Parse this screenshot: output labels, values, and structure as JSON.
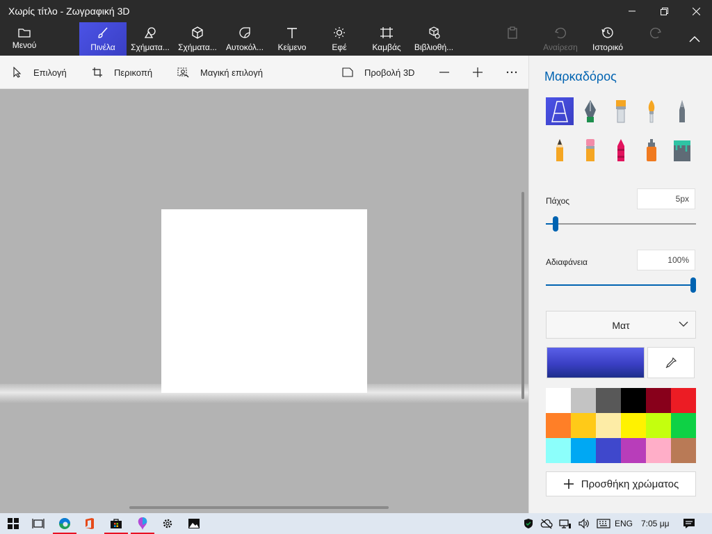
{
  "window": {
    "title": "Χωρίς τίτλο - Ζωγραφική 3D"
  },
  "ribbon": {
    "menu": "Μενού",
    "brushes": "Πινέλα",
    "shapes2d": "Σχήματα...",
    "shapes3d": "Σχήματα...",
    "stickers": "Αυτοκόλ...",
    "text": "Κείμενο",
    "effects": "Εφέ",
    "canvas": "Καμβάς",
    "library": "Βιβλιοθή...",
    "undo": "Αναίρεση",
    "history": "Ιστορικό"
  },
  "toolbar": {
    "select": "Επιλογή",
    "crop": "Περικοπή",
    "magic_select": "Μαγική επιλογή",
    "view3d": "Προβολή 3D"
  },
  "panel": {
    "title": "Μαρκαδόρος",
    "thickness_label": "Πάχος",
    "thickness_value": "5px",
    "thickness_level": 0.05,
    "opacity_label": "Αδιαφάνεια",
    "opacity_value": "100%",
    "opacity_level": 1.0,
    "finish_value": "Ματ",
    "add_color": "Προσθήκη χρώματος",
    "current_color": "#3a3fc4",
    "palette": [
      "#ffffff",
      "#c3c3c3",
      "#585858",
      "#000000",
      "#88001b",
      "#ec1c24",
      "#ff7f27",
      "#ffca18",
      "#fdeca6",
      "#fff200",
      "#c4ff0e",
      "#0ed145",
      "#8cfffb",
      "#00a8f3",
      "#3f48cc",
      "#b83dba",
      "#ffaec8",
      "#b97a56"
    ]
  },
  "accent_color": "#3f48cc",
  "taskbar": {
    "language": "ENG",
    "time": "7:05 μμ"
  }
}
